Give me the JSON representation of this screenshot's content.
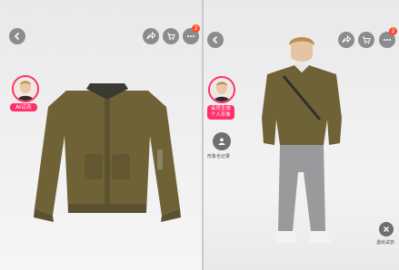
{
  "left_panel": {
    "ai_tryon_label": "AI试衣",
    "cart_badge_count": "2"
  },
  "right_panel": {
    "generated_label_line1": "会员生成",
    "generated_label_line2": "个人形象",
    "saved_looks_label": "形象也记录",
    "exit_tryon_label": "退出试衣",
    "cart_badge_count": "2"
  },
  "colors": {
    "accent_pink": "#ff2f6a",
    "badge_red": "#ff4a2a",
    "jacket_olive": "#6f6236"
  },
  "icons": [
    "back-icon",
    "share-icon",
    "cart-icon",
    "more-icon",
    "person-icon",
    "close-icon"
  ]
}
